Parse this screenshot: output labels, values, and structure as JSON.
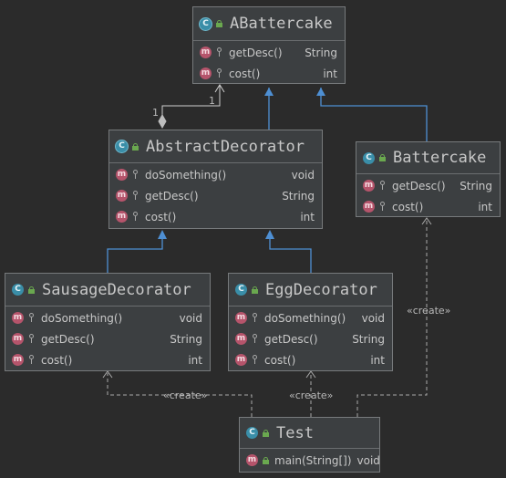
{
  "classes": {
    "abattercake": {
      "icon": "C",
      "icon_name": "abstract-class-icon",
      "name": "ABattercake",
      "methods": [
        {
          "name": "getDesc()",
          "type": "String"
        },
        {
          "name": "cost()",
          "type": "int"
        }
      ]
    },
    "abstract_decorator": {
      "icon": "C",
      "icon_name": "abstract-class-icon",
      "name": "AbstractDecorator",
      "methods": [
        {
          "name": "doSomething()",
          "type": "void"
        },
        {
          "name": "getDesc()",
          "type": "String"
        },
        {
          "name": "cost()",
          "type": "int"
        }
      ]
    },
    "battercake": {
      "icon": "C",
      "icon_name": "class-icon",
      "name": "Battercake",
      "methods": [
        {
          "name": "getDesc()",
          "type": "String"
        },
        {
          "name": "cost()",
          "type": "int"
        }
      ]
    },
    "sausage_decorator": {
      "icon": "C",
      "icon_name": "class-icon",
      "name": "SausageDecorator",
      "methods": [
        {
          "name": "doSomething()",
          "type": "void"
        },
        {
          "name": "getDesc()",
          "type": "String"
        },
        {
          "name": "cost()",
          "type": "int"
        }
      ]
    },
    "egg_decorator": {
      "icon": "C",
      "icon_name": "class-icon",
      "name": "EggDecorator",
      "methods": [
        {
          "name": "doSomething()",
          "type": "void"
        },
        {
          "name": "getDesc()",
          "type": "String"
        },
        {
          "name": "cost()",
          "type": "int"
        }
      ]
    },
    "test": {
      "icon": "C",
      "icon_name": "class-icon",
      "name": "Test",
      "methods": [
        {
          "name": "main(String[])",
          "type": "void"
        }
      ]
    }
  },
  "method_badge": "m",
  "relations": {
    "aggregation_multiplicity_top": "1",
    "aggregation_multiplicity_bottom": "1",
    "create_label": "«create»"
  },
  "colors": {
    "background": "#2b2b2b",
    "box": "#3c3f41",
    "inheritance": "#4e8fd3",
    "dependency": "#a9a9a9",
    "method_icon": "#b5546b",
    "class_icon": "#3a8ea8"
  }
}
